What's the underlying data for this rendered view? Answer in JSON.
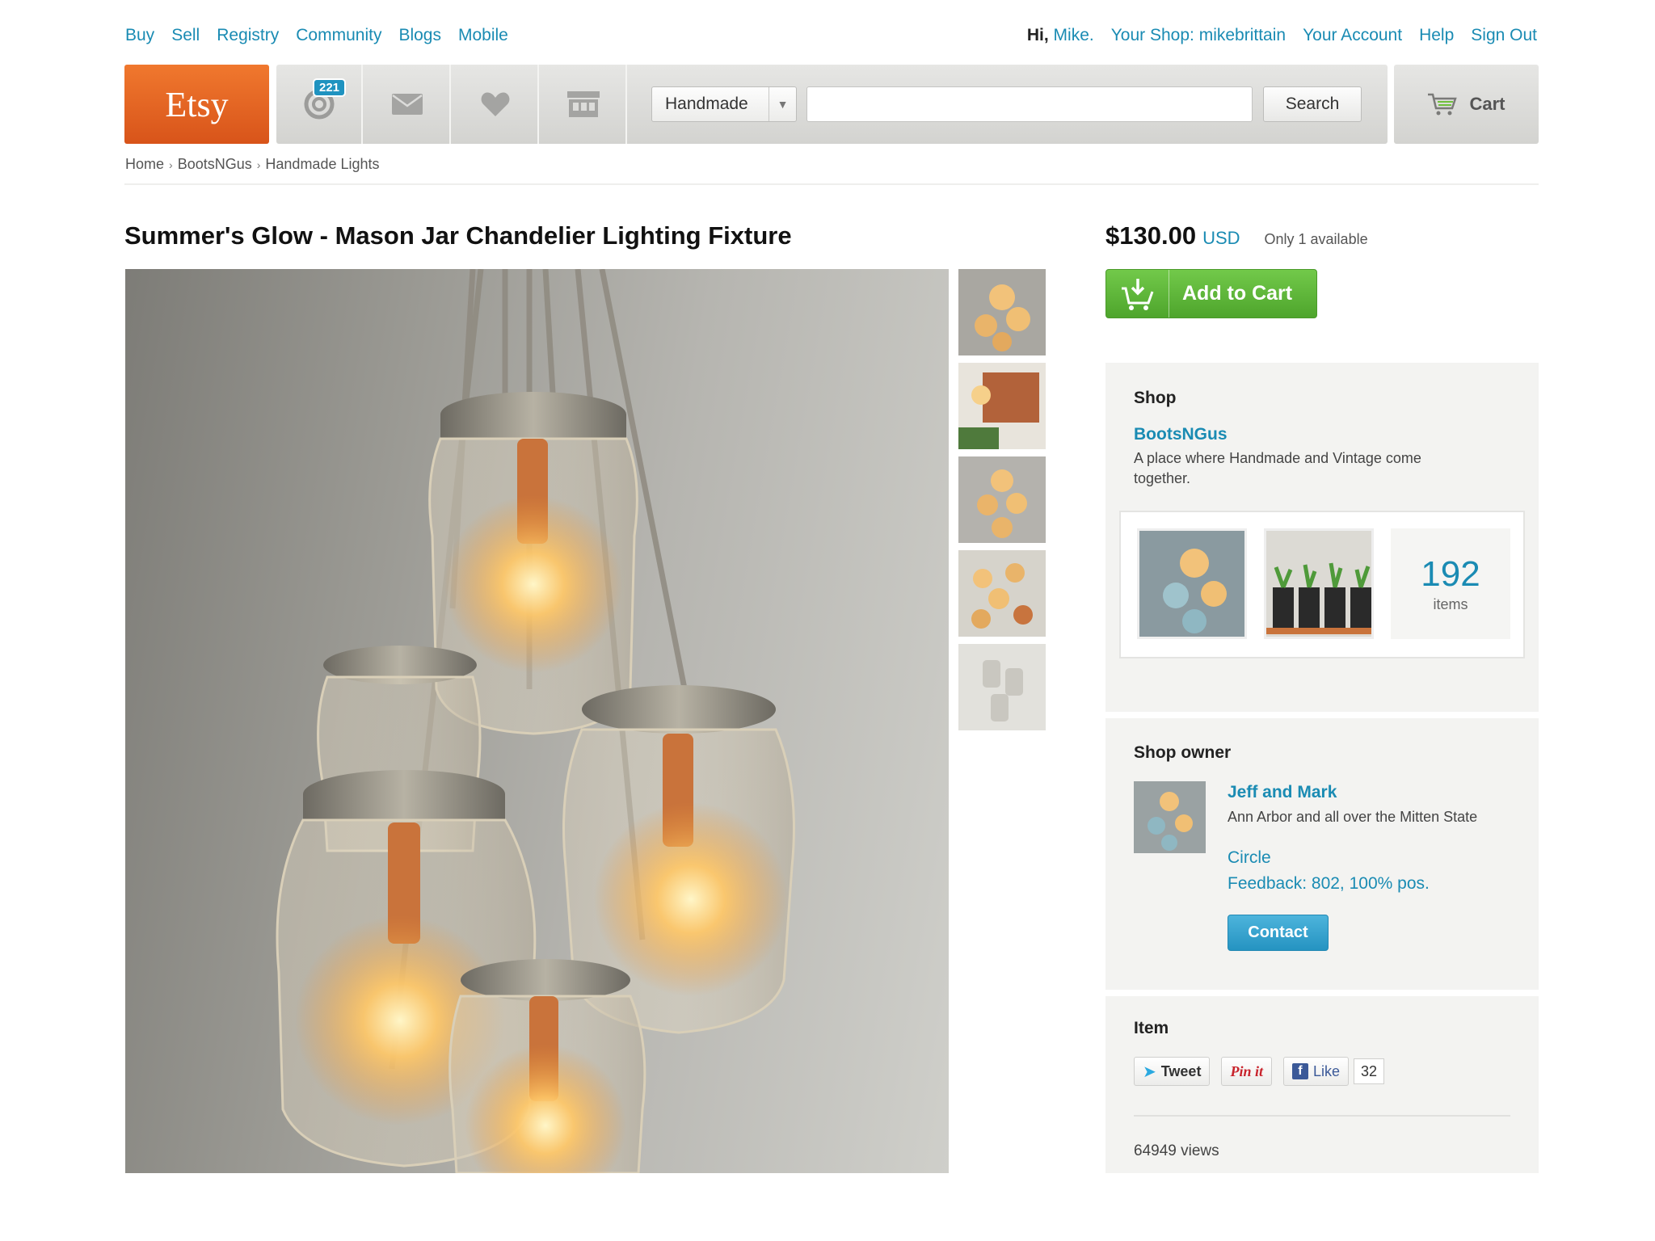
{
  "topnav": {
    "left": [
      "Buy",
      "Sell",
      "Registry",
      "Community",
      "Blogs",
      "Mobile"
    ],
    "greeting": "Hi, ",
    "user": "Mike.",
    "your_shop": "Your Shop: mikebrittain",
    "your_account": "Your Account",
    "help": "Help",
    "sign_out": "Sign Out"
  },
  "header": {
    "logo": "Etsy",
    "activity_count": "221",
    "icons": [
      "activity-icon",
      "mail-icon",
      "heart-icon",
      "shop-icon"
    ],
    "search_category": "Handmade",
    "search_placeholder": "",
    "search_button": "Search",
    "cart_label": "Cart"
  },
  "breadcrumb": [
    "Home",
    "BootsNGus",
    "Handmade Lights"
  ],
  "listing": {
    "title": "Summer's Glow - Mason Jar Chandelier Lighting Fixture",
    "price": "$130.00",
    "currency": "USD",
    "availability": "Only 1 available",
    "add_to_cart": "Add to Cart"
  },
  "shop": {
    "heading": "Shop",
    "name": "BootsNGus",
    "description": "A place where Handmade and Vintage come together.",
    "item_count": "192",
    "item_count_label": "items"
  },
  "owner": {
    "heading": "Shop owner",
    "name": "Jeff and Mark",
    "location": "Ann Arbor and all over the Mitten State",
    "circle": "Circle",
    "feedback": "Feedback: 802, 100% pos.",
    "contact": "Contact"
  },
  "item": {
    "heading": "Item",
    "tweet": "Tweet",
    "pin": "Pin it",
    "like": "Like",
    "like_count": "32",
    "views": "64949 views"
  },
  "colors": {
    "brand_orange": "#e5642a",
    "link_blue": "#1a8bb3",
    "cart_green": "#5bb536",
    "contact_blue": "#2fa0cc"
  }
}
